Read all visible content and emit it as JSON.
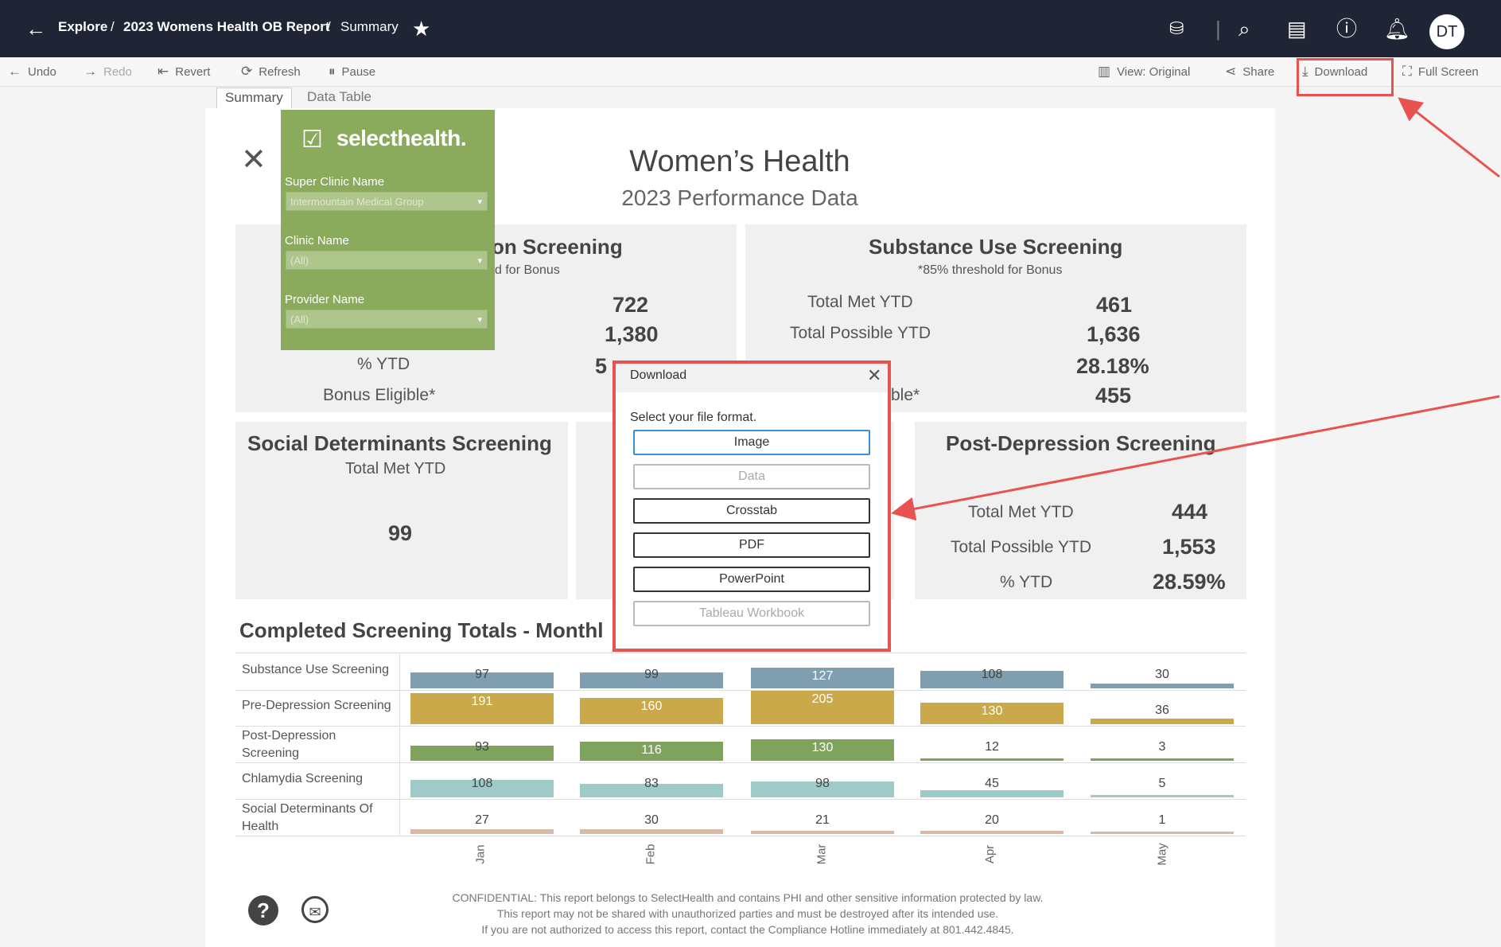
{
  "breadcrumb": {
    "explore": "Explore",
    "sep": "/",
    "report": "2023 Womens Health OB Report",
    "page": "Summary"
  },
  "user": {
    "initials": "DT"
  },
  "toolbar": {
    "undo": "Undo",
    "redo": "Redo",
    "revert": "Revert",
    "refresh": "Refresh",
    "pause": "Pause",
    "view": "View: Original",
    "share": "Share",
    "download": "Download",
    "fullscreen": "Full Screen"
  },
  "tabs": [
    "Summary",
    "Data Table"
  ],
  "header": {
    "title": "Women’s Health",
    "subtitle": "2023 Performance Data"
  },
  "filters": {
    "logo": "selecthealth.",
    "super_clinic_label": "Super Clinic Name",
    "super_clinic_value": "Intermountain Medical Group",
    "clinic_label": "Clinic Name",
    "clinic_value": "(All)",
    "provider_label": "Provider Name",
    "provider_value": "(All)"
  },
  "pre_depression": {
    "title_partial": "on Screening",
    "sub_partial": "d for Bonus",
    "met": "722",
    "possible": "1,380",
    "pct_partial": "5",
    "pct_label": "% YTD",
    "bonus_label": "Bonus Eligible*"
  },
  "substance": {
    "title": "Substance Use Screening",
    "subtitle": "*85% threshold for Bonus",
    "met_label": "Total Met YTD",
    "met": "461",
    "possible_label": "Total Possible YTD",
    "possible": "1,636",
    "pct": "28.18%",
    "bonus_partial": "ble*",
    "bonus": "455"
  },
  "social": {
    "title": "Social Determinants Screening",
    "subtitle": "Total Met YTD",
    "value": "99"
  },
  "post_depression": {
    "title": "Post-Depression Screening",
    "met_label": "Total Met YTD",
    "met": "444",
    "possible_label": "Total Possible YTD",
    "possible": "1,553",
    "pct_label": "% YTD",
    "pct": "28.59%"
  },
  "chart_title": "Completed Screening Totals - Monthl",
  "chart_data": {
    "type": "bar",
    "categories": [
      "Jan",
      "Feb",
      "Mar",
      "Apr",
      "May"
    ],
    "series": [
      {
        "name": "Substance Use Screening",
        "values": [
          97,
          99,
          127,
          108,
          30
        ],
        "color": "#7f9fb0"
      },
      {
        "name": "Pre-Depression Screening",
        "values": [
          191,
          160,
          205,
          130,
          36
        ],
        "color": "#c9a94a"
      },
      {
        "name": "Post-Depression Screening",
        "values": [
          93,
          116,
          130,
          12,
          3
        ],
        "color": "#7fa35c"
      },
      {
        "name": "Chlamydia Screening",
        "values": [
          108,
          83,
          98,
          45,
          5
        ],
        "color": "#9ecbc7"
      },
      {
        "name": "Social Determinants Of Health",
        "values": [
          27,
          30,
          21,
          20,
          1
        ],
        "color": "#d9b8a6"
      }
    ],
    "row_labels": [
      "Substance Use Screening",
      "Pre-Depression Screening",
      "Post-Depression\nScreening",
      "Chlamydia Screening",
      "Social Determinants Of\nHealth"
    ]
  },
  "dialog": {
    "title": "Download",
    "prompt": "Select your file format.",
    "options": [
      "Image",
      "Data",
      "Crosstab",
      "PDF",
      "PowerPoint",
      "Tableau Workbook"
    ]
  },
  "footer": {
    "line1": "CONFIDENTIAL: This report belongs to SelectHealth and contains PHI and other sensitive information protected by law.",
    "line2": "This report may not be shared with unauthorized parties and must be destroyed after its intended use.",
    "line3": "If you are not authorized to access this report, contact the Compliance Hotline immediately at 801.442.4845."
  },
  "colors": {
    "accent_red": "#e8534f",
    "topbar": "#1f2535",
    "filter_green": "#8aab5c"
  }
}
